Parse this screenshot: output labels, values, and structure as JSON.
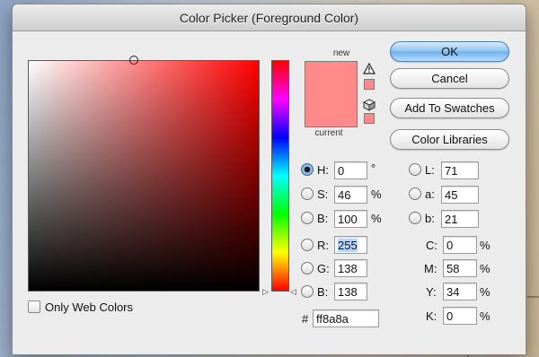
{
  "dialog": {
    "title": "Color Picker (Foreground Color)"
  },
  "colors": {
    "new": "#ff8a8a",
    "current": "#ff8a8a",
    "field_hue": "#ff0000"
  },
  "preview": {
    "new_label": "new",
    "current_label": "current",
    "gamut_warning_icon": "warning-triangle-icon",
    "web_safe_icon": "cube-icon"
  },
  "buttons": {
    "ok": "OK",
    "cancel": "Cancel",
    "add_to_swatches": "Add To Swatches",
    "color_libraries": "Color Libraries"
  },
  "hsb": {
    "h": {
      "label": "H:",
      "value": "0",
      "unit": "°",
      "selected": true
    },
    "s": {
      "label": "S:",
      "value": "46",
      "unit": "%"
    },
    "b": {
      "label": "B:",
      "value": "100",
      "unit": "%"
    }
  },
  "rgb": {
    "r": {
      "label": "R:",
      "value": "255"
    },
    "g": {
      "label": "G:",
      "value": "138"
    },
    "b": {
      "label": "B:",
      "value": "138"
    }
  },
  "lab": {
    "l": {
      "label": "L:",
      "value": "71"
    },
    "a": {
      "label": "a:",
      "value": "45"
    },
    "b": {
      "label": "b:",
      "value": "21"
    }
  },
  "cmyk": {
    "c": {
      "label": "C:",
      "value": "0",
      "unit": "%"
    },
    "m": {
      "label": "M:",
      "value": "58",
      "unit": "%"
    },
    "y": {
      "label": "Y:",
      "value": "34",
      "unit": "%"
    },
    "k": {
      "label": "K:",
      "value": "0",
      "unit": "%"
    }
  },
  "hex": {
    "label": "#",
    "value": "ff8a8a"
  },
  "only_web_colors": {
    "label": "Only Web Colors",
    "checked": false
  },
  "hue_slider_position": 0
}
